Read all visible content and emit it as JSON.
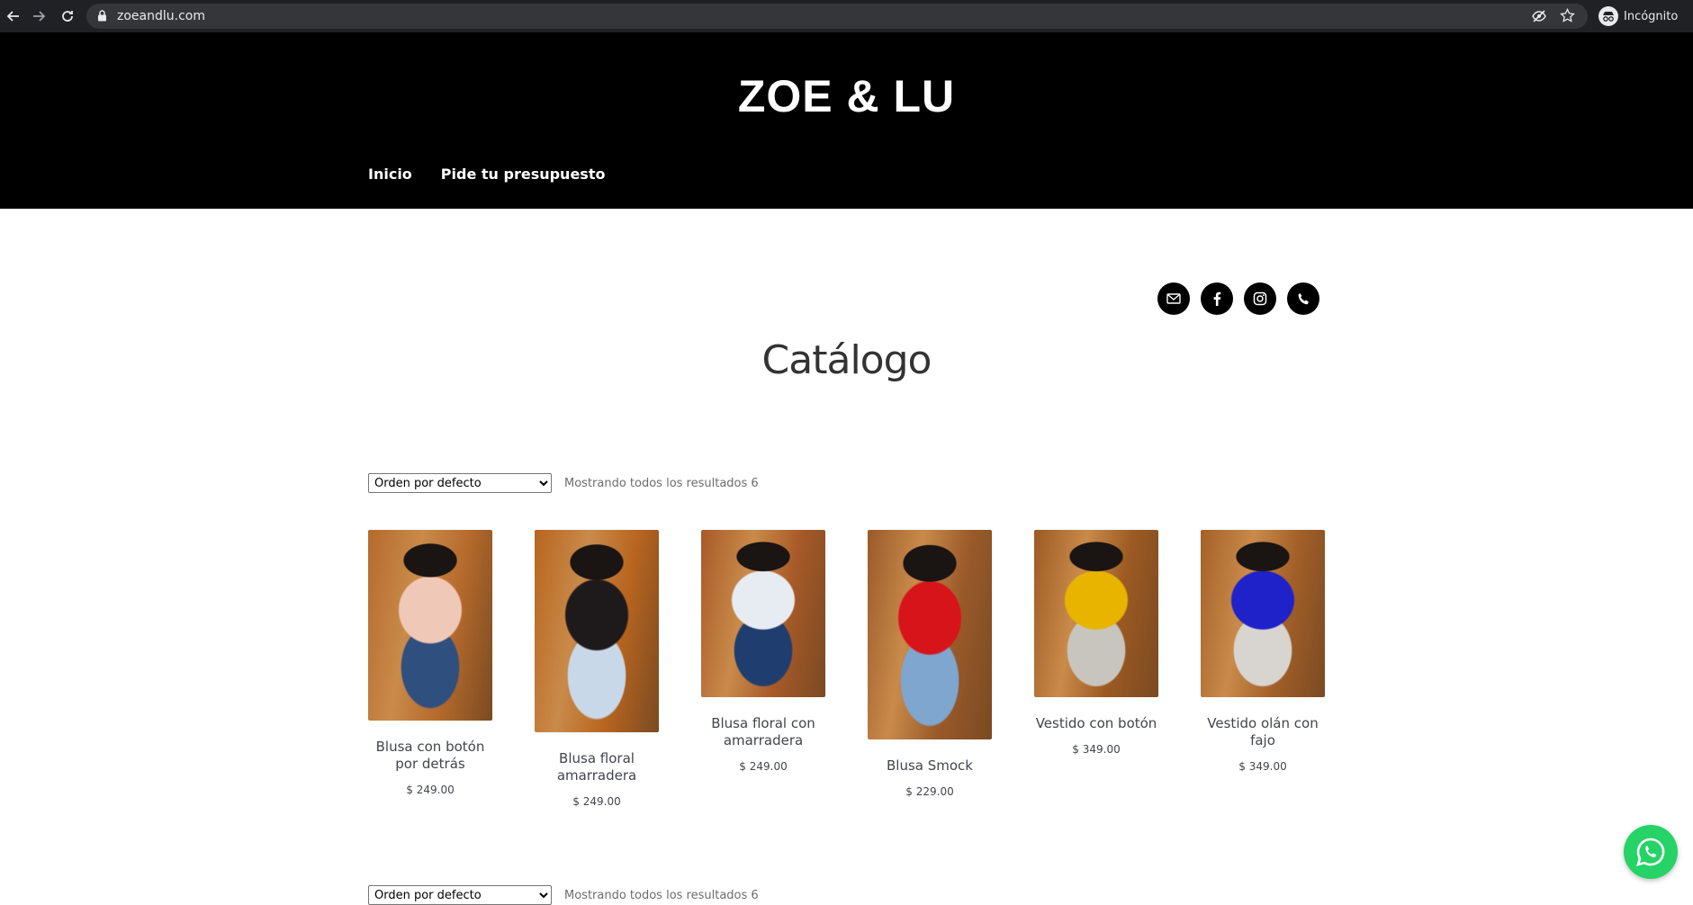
{
  "browser": {
    "url": "zoeandlu.com",
    "incognito_label": "Incógnito"
  },
  "site": {
    "title": "ZOE & LU",
    "nav": [
      "Inicio",
      "Pide tu presupuesto"
    ]
  },
  "social_icons": [
    "mail-icon",
    "facebook-icon",
    "instagram-icon",
    "phone-icon"
  ],
  "page_title": "Catálogo",
  "sorting": {
    "selected": "Orden por defecto",
    "result_count": "Mostrando todos los resultados 6"
  },
  "products": [
    {
      "name": "Blusa con botón por detrás",
      "price": "$ 249.00",
      "photo": "woman in pink blouse and jeans",
      "colors": [
        "#b56a2c",
        "#f0c8b8",
        "#2f4f7f"
      ]
    },
    {
      "name": "Blusa floral amarradera",
      "price": "$ 249.00",
      "photo": "woman in black floral top and light jeans",
      "colors": [
        "#b8651f",
        "#1e1a1c",
        "#c9d8e8"
      ]
    },
    {
      "name": "Blusa floral con amarradera",
      "price": "$ 249.00",
      "photo": "woman in white floral blouse and jeans",
      "colors": [
        "#a85a28",
        "#e6ecf2",
        "#1f3d6e"
      ]
    },
    {
      "name": "Blusa Smock",
      "price": "$ 229.00",
      "photo": "woman in red top and denim shorts",
      "colors": [
        "#9a5a2a",
        "#d7141a",
        "#7ea6cf"
      ]
    },
    {
      "name": "Vestido con botón",
      "price": "$ 349.00",
      "photo": "woman in yellow dress",
      "colors": [
        "#9c5a22",
        "#e8b400",
        "#c8c5bf"
      ]
    },
    {
      "name": "Vestido olán con fajo",
      "price": "$ 349.00",
      "photo": "woman in blue ruffle dress",
      "colors": [
        "#a36028",
        "#1e22c8",
        "#d8d5d0"
      ]
    }
  ],
  "colors": {
    "header_bg": "#000000",
    "chrome_bg": "#202124",
    "whatsapp": "#25d366"
  }
}
